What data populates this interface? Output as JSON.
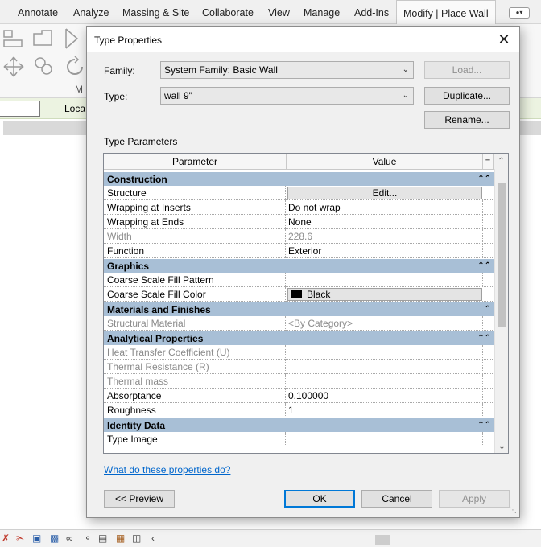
{
  "ribbon": {
    "tabs": [
      "Annotate",
      "Analyze",
      "Massing & Site",
      "Collaborate",
      "View",
      "Manage",
      "Add-Ins",
      "Modify | Place Wall"
    ],
    "panel_label_partial": "M"
  },
  "options_bar": {
    "label_partial": "Loca"
  },
  "dialog": {
    "title": "Type Properties",
    "family_label": "Family:",
    "family_value": "System Family: Basic Wall",
    "type_label": "Type:",
    "type_value": "wall 9\"",
    "load_button": "Load...",
    "duplicate_button": "Duplicate...",
    "rename_button": "Rename...",
    "section_label": "Type Parameters",
    "grid": {
      "col_parameter": "Parameter",
      "col_value": "Value",
      "col_eq": "=",
      "groups": [
        {
          "name": "Construction",
          "rows": [
            {
              "param": "Structure",
              "value": "Edit...",
              "kind": "button"
            },
            {
              "param": "Wrapping at Inserts",
              "value": "Do not wrap"
            },
            {
              "param": "Wrapping at Ends",
              "value": "None"
            },
            {
              "param": "Width",
              "value": "228.6",
              "dim": true
            },
            {
              "param": "Function",
              "value": "Exterior"
            }
          ]
        },
        {
          "name": "Graphics",
          "rows": [
            {
              "param": "Coarse Scale Fill Pattern",
              "value": ""
            },
            {
              "param": "Coarse Scale Fill Color",
              "value": "Black",
              "kind": "color"
            }
          ]
        },
        {
          "name": "Materials and Finishes",
          "rows": [
            {
              "param": "Structural Material",
              "value": "<By Category>",
              "dim": true
            }
          ]
        },
        {
          "name": "Analytical Properties",
          "rows": [
            {
              "param": "Heat Transfer Coefficient (U)",
              "value": "",
              "dim": true
            },
            {
              "param": "Thermal Resistance (R)",
              "value": "",
              "dim": true
            },
            {
              "param": "Thermal mass",
              "value": "",
              "dim": true
            },
            {
              "param": "Absorptance",
              "value": "0.100000"
            },
            {
              "param": "Roughness",
              "value": "1"
            }
          ]
        },
        {
          "name": "Identity Data",
          "rows": [
            {
              "param": "Type Image",
              "value": ""
            }
          ]
        }
      ]
    },
    "help_link": "What do these properties do?",
    "preview_button": "<< Preview",
    "ok_button": "OK",
    "cancel_button": "Cancel",
    "apply_button": "Apply"
  },
  "colors": {
    "group_header": "#a8bfd6",
    "options_bar": "#ecf3e1",
    "link": "#0066cc",
    "swatch_black": "#000000"
  }
}
